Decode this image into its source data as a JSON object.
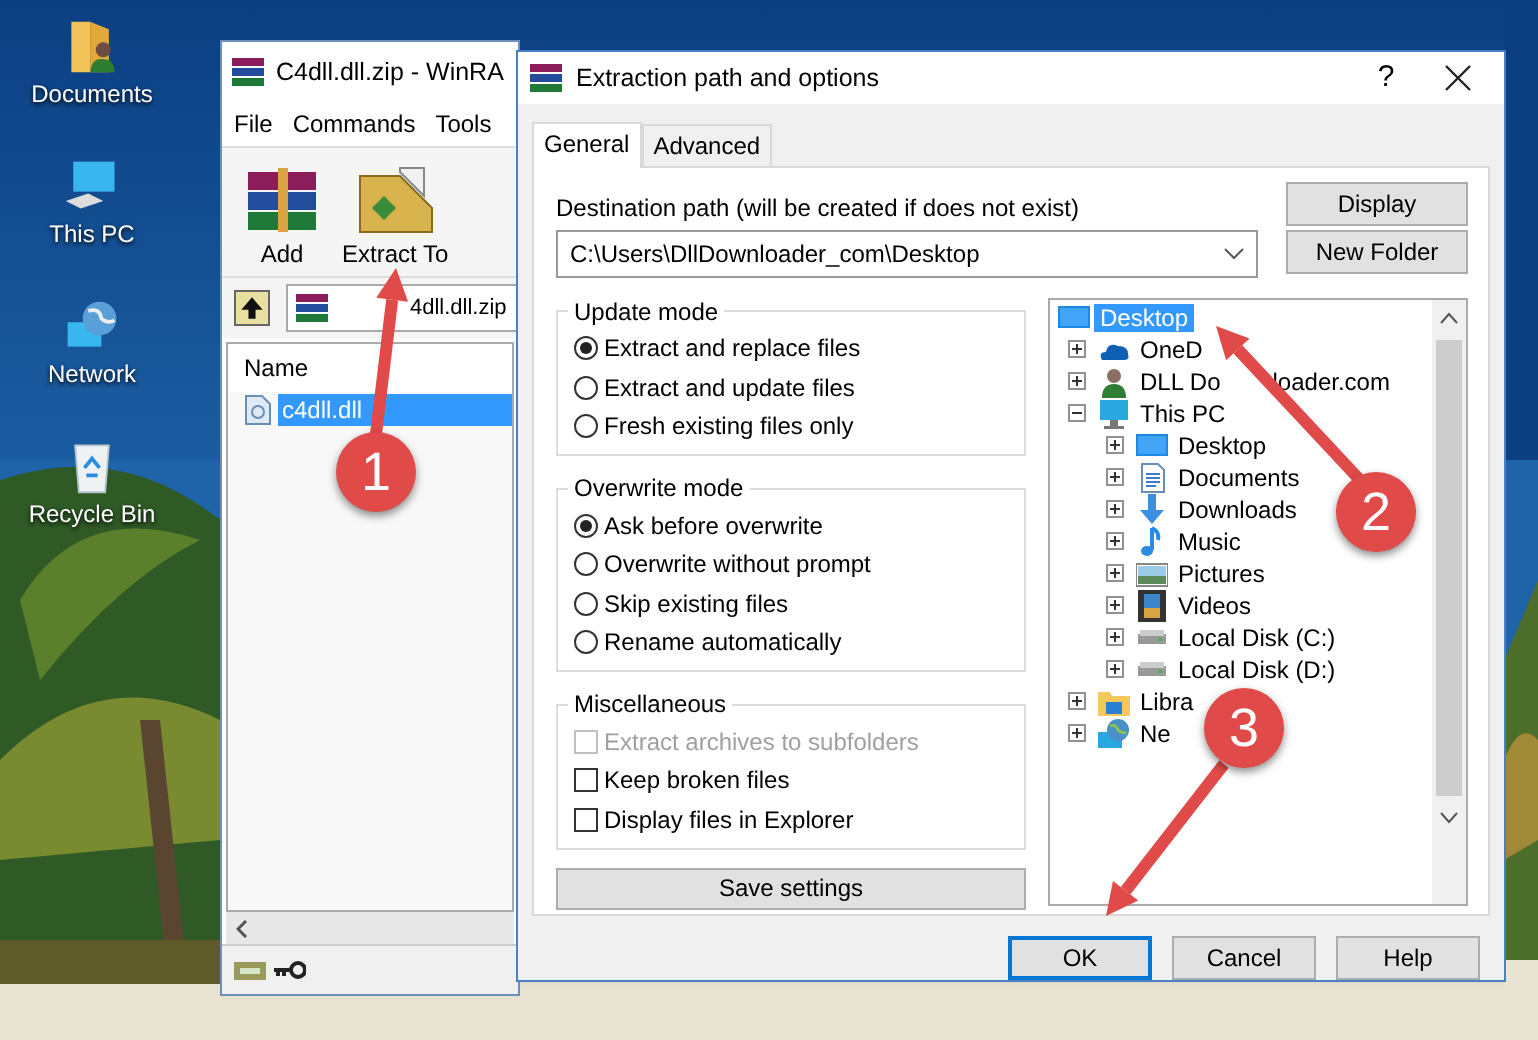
{
  "desktop": {
    "icons": [
      {
        "label": "Documents",
        "kind": "documents"
      },
      {
        "label": "This PC",
        "kind": "pc"
      },
      {
        "label": "Network",
        "kind": "network"
      },
      {
        "label": "Recycle Bin",
        "kind": "recycle"
      }
    ]
  },
  "archiver": {
    "title": "C4dll.dll.zip - WinRA",
    "menu": [
      "File",
      "Commands",
      "Tools"
    ],
    "toolbar": [
      {
        "label": "Add",
        "kind": "add"
      },
      {
        "label": "Extract To",
        "kind": "extract"
      }
    ],
    "path": "4dll.dll.zip",
    "columns": [
      "Name"
    ],
    "files": [
      {
        "name": "c4dll.dll",
        "selected": true
      }
    ]
  },
  "dialog": {
    "title": "Extraction path and options",
    "help_glyph": "?",
    "tabs": [
      {
        "label": "General",
        "selected": true
      },
      {
        "label": "Advanced",
        "selected": false
      }
    ],
    "destination": {
      "label": "Destination path (will be created if does not exist)",
      "value": "C:\\Users\\DllDownloader_com\\Desktop"
    },
    "side_buttons": [
      "Display",
      "New Folder"
    ],
    "groups": [
      {
        "title": "Update mode",
        "options": [
          {
            "kind": "radio",
            "label": "Extract and replace files",
            "selected": true
          },
          {
            "kind": "radio",
            "label": "Extract and update files",
            "selected": false
          },
          {
            "kind": "radio",
            "label": "Fresh existing files only",
            "selected": false
          }
        ]
      },
      {
        "title": "Overwrite mode",
        "options": [
          {
            "kind": "radio",
            "label": "Ask before overwrite",
            "selected": true
          },
          {
            "kind": "radio",
            "label": "Overwrite without prompt",
            "selected": false
          },
          {
            "kind": "radio",
            "label": "Skip existing files",
            "selected": false
          },
          {
            "kind": "radio",
            "label": "Rename automatically",
            "selected": false
          }
        ]
      },
      {
        "title": "Miscellaneous",
        "options": [
          {
            "kind": "checkbox",
            "label": "Extract archives to subfolders",
            "checked": false,
            "disabled": true
          },
          {
            "kind": "checkbox",
            "label": "Keep broken files",
            "checked": false,
            "disabled": false
          },
          {
            "kind": "checkbox",
            "label": "Display files in Explorer",
            "checked": false,
            "disabled": false
          }
        ]
      }
    ],
    "save_button": "Save settings",
    "tree": [
      {
        "label": "Desktop",
        "kind": "desktop",
        "selected": true,
        "children": [
          {
            "label": "OneD",
            "kind": "cloud",
            "expanded": false,
            "selected": false
          },
          {
            "label": "DLL Do",
            "label_rest": "loader.com",
            "kind": "user",
            "expanded": false,
            "selected": false
          },
          {
            "label": "This PC",
            "kind": "pc",
            "expanded": true,
            "selected": false,
            "children": [
              {
                "label": "Desktop",
                "kind": "desktop",
                "expanded": false,
                "selected": false
              },
              {
                "label": "Documents",
                "kind": "documents",
                "expanded": false,
                "selected": false
              },
              {
                "label": "Downloads",
                "kind": "downloads",
                "expanded": false,
                "selected": false
              },
              {
                "label": "Music",
                "kind": "music",
                "expanded": false,
                "selected": false
              },
              {
                "label": "Pictures",
                "kind": "pictures",
                "expanded": false,
                "selected": false
              },
              {
                "label": "Videos",
                "kind": "videos",
                "expanded": false,
                "selected": false
              },
              {
                "label": "Local Disk (C:)",
                "kind": "disk",
                "expanded": false,
                "selected": false
              },
              {
                "label": "Local Disk (D:)",
                "kind": "disk",
                "expanded": false,
                "selected": false
              }
            ]
          },
          {
            "label": "Libra",
            "kind": "library",
            "expanded": false,
            "selected": false
          },
          {
            "label": "Ne",
            "kind": "network",
            "expanded": false,
            "selected": false
          }
        ]
      }
    ],
    "buttons": [
      {
        "label": "OK",
        "default": true
      },
      {
        "label": "Cancel",
        "default": false
      },
      {
        "label": "Help",
        "default": false
      }
    ]
  },
  "callouts": [
    {
      "number": "1"
    },
    {
      "number": "2"
    },
    {
      "number": "3"
    }
  ]
}
